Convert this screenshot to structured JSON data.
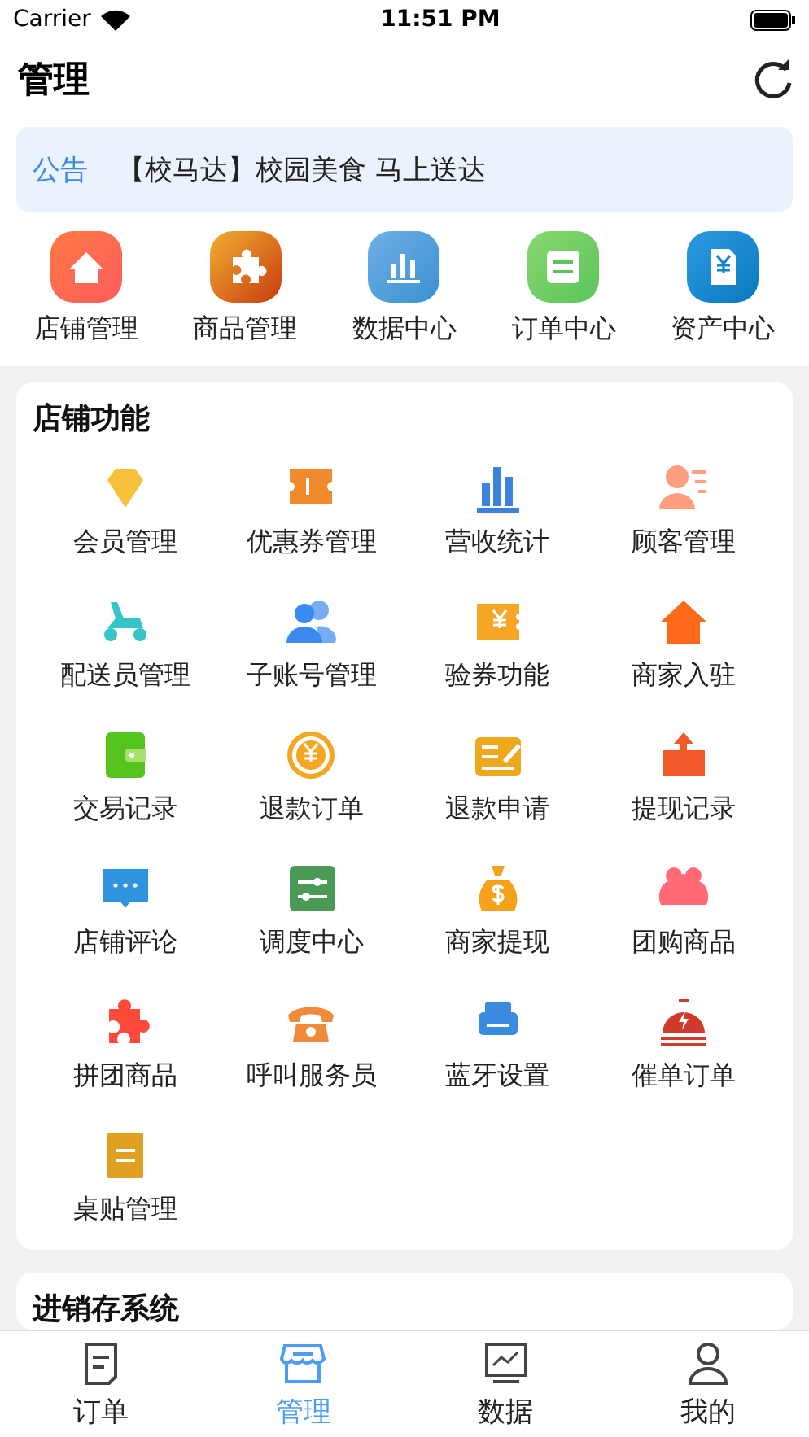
{
  "status_bar": {
    "carrier": "Carrier",
    "time": "11:51 PM"
  },
  "header": {
    "title": "管理"
  },
  "notice": {
    "label": "公告",
    "text": "【校马达】校园美食 马上送达"
  },
  "quick_links": [
    {
      "label": "店铺管理"
    },
    {
      "label": "商品管理"
    },
    {
      "label": "数据中心"
    },
    {
      "label": "订单中心"
    },
    {
      "label": "资产中心"
    }
  ],
  "store_functions": {
    "title": "店铺功能",
    "items": [
      {
        "label": "会员管理"
      },
      {
        "label": "优惠券管理"
      },
      {
        "label": "营收统计"
      },
      {
        "label": "顾客管理"
      },
      {
        "label": "配送员管理"
      },
      {
        "label": "子账号管理"
      },
      {
        "label": "验券功能"
      },
      {
        "label": "商家入驻"
      },
      {
        "label": "交易记录"
      },
      {
        "label": "退款订单"
      },
      {
        "label": "退款申请"
      },
      {
        "label": "提现记录"
      },
      {
        "label": "店铺评论"
      },
      {
        "label": "调度中心"
      },
      {
        "label": "商家提现"
      },
      {
        "label": "团购商品"
      },
      {
        "label": "拼团商品"
      },
      {
        "label": "呼叫服务员"
      },
      {
        "label": "蓝牙设置"
      },
      {
        "label": "催单订单"
      },
      {
        "label": "桌贴管理"
      }
    ]
  },
  "inventory": {
    "title": "进销存系统"
  },
  "tab_bar": [
    {
      "label": "订单",
      "selected": false
    },
    {
      "label": "管理",
      "selected": true
    },
    {
      "label": "数据",
      "selected": false
    },
    {
      "label": "我的",
      "selected": false
    }
  ]
}
